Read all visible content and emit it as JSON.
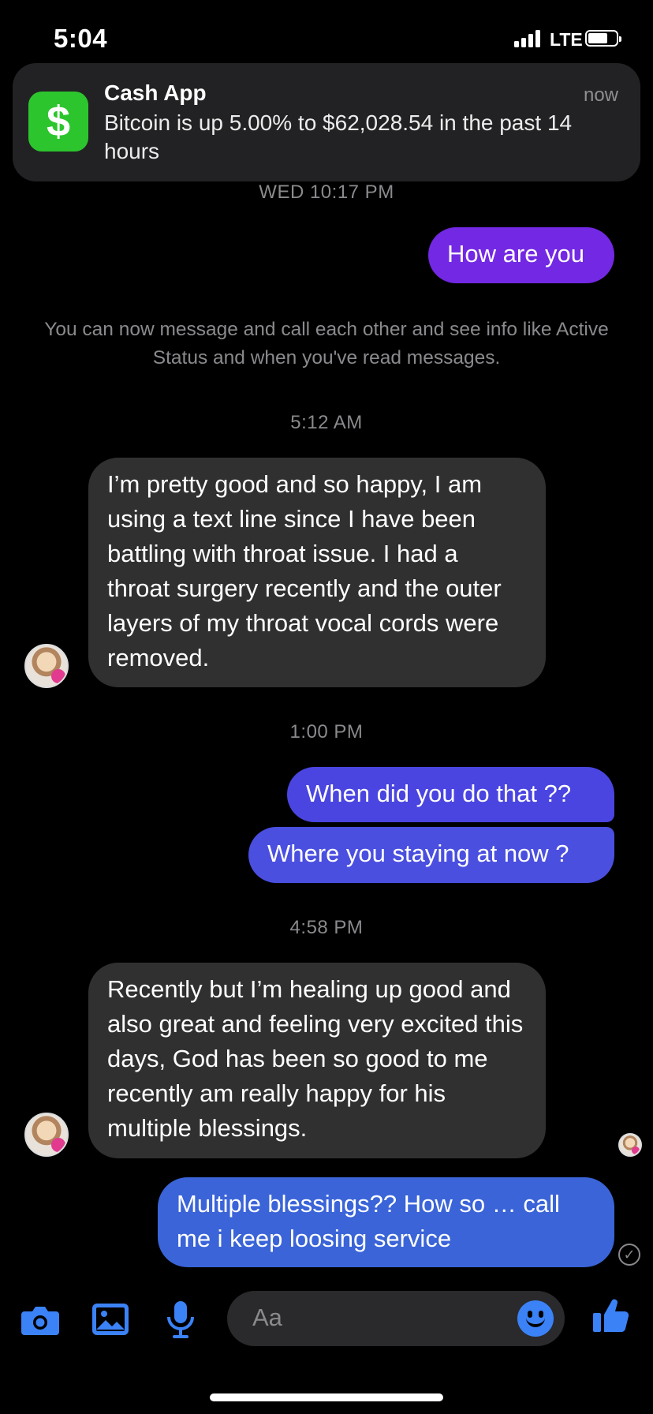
{
  "status_bar": {
    "time": "5:04",
    "network": "LTE",
    "battery_level": 0.7
  },
  "notification": {
    "app": "Cash App",
    "icon_glyph": "$",
    "time": "now",
    "body": "Bitcoin is up 5.00% to $62,028.54 in the past 14 hours"
  },
  "thread": {
    "stamp_1": "WED 10:17 PM",
    "msg_1": "How are you",
    "system_message": "You can now message and call each other and see info like Active Status and when you've read messages.",
    "stamp_2": "5:12 AM",
    "msg_2": "I’m pretty good and so happy, I am using a text line since I have been battling with  throat issue. I had a throat surgery recently and the outer layers of my throat vocal cords were removed.",
    "stamp_3": "1:00 PM",
    "msg_3": "When did you do that ??",
    "msg_4": "Where you staying at now ?",
    "stamp_4": "4:58 PM",
    "msg_5": "Recently but I’m healing up good and also  great and feeling very excited this days, God has been so good to me recently am really happy for his multiple blessings.",
    "msg_6": "Multiple blessings?? How so … call me i keep loosing service"
  },
  "composer": {
    "placeholder": "Aa"
  },
  "colors": {
    "accent": "#3b82f6",
    "out_bubble_purple": "#7328e3",
    "out_bubble_indigo": "#4a45e0",
    "out_bubble_blue": "#3a64d8",
    "in_bubble": "#303030",
    "cash_green": "#2dc52d"
  },
  "icons": [
    "camera-icon",
    "photo-icon",
    "microphone-icon",
    "emoji-icon",
    "thumbs-up-icon",
    "sent-check-icon"
  ]
}
